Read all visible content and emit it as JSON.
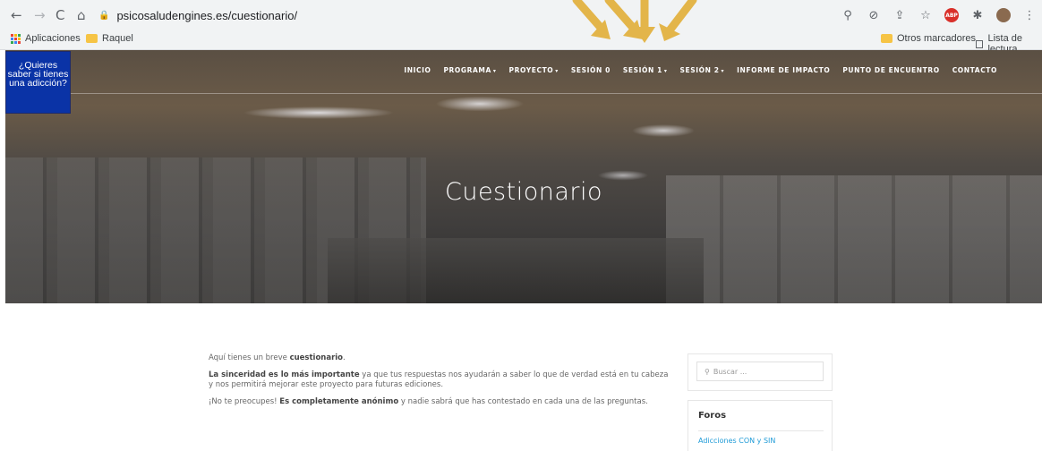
{
  "browser": {
    "url": "psicosaludengines.es/cuestionario/",
    "nav_back": "←",
    "nav_forward": "→",
    "nav_reload": "C",
    "nav_home": "⌂",
    "lock": "🔒",
    "extension_icons": [
      "zoom-icon",
      "eye-off-icon",
      "share-icon",
      "star-icon",
      "adblock-icon",
      "puzzle-icon",
      "profile-avatar",
      "menu-icon"
    ],
    "extension_glyphs": [
      "⚲",
      "⊘",
      "⇪",
      "☆",
      "ABP",
      "✱",
      "●",
      "⋮"
    ],
    "bookmarks": {
      "apps": "Aplicaciones",
      "item1": "Raquel",
      "others": "Otros marcadores",
      "reading_list": "Lista de lectura"
    }
  },
  "site": {
    "nav": [
      {
        "label": "INICIO",
        "caret": false
      },
      {
        "label": "PROGRAMA",
        "caret": true
      },
      {
        "label": "PROYECTO",
        "caret": true
      },
      {
        "label": "SESIÓN 0",
        "caret": false
      },
      {
        "label": "SESIÓN 1",
        "caret": true
      },
      {
        "label": "SESIÓN 2",
        "caret": true
      },
      {
        "label": "INFORME DE IMPACTO",
        "caret": false
      },
      {
        "label": "PUNTO DE ENCUENTRO",
        "caret": false
      },
      {
        "label": "CONTACTO",
        "caret": false
      }
    ],
    "caret_glyph": "▾",
    "hero_title": "Cuestionario",
    "widget": {
      "line1": "¿Quieres",
      "line2": "saber si tienes",
      "line3": "una adicción?"
    }
  },
  "content": {
    "p1_pre": "Aquí tienes un breve ",
    "p1_bold": "cuestionario",
    "p1_post": ".",
    "p2_bold": "La sinceridad es lo más importante",
    "p2_post": " ya que tus respuestas nos ayudarán a saber lo que de verdad está en tu cabeza y nos permitirá mejorar este proyecto para futuras ediciones.",
    "p3_pre": "¡No te preocupes! ",
    "p3_bold": "Es completamente anónimo",
    "p3_post": " y nadie sabrá que has contestado en cada una de las preguntas."
  },
  "sidebar": {
    "search_placeholder": "Buscar ...",
    "foros_title": "Foros",
    "foros_link": "Adicciones CON y SIN"
  },
  "colors": {
    "widget_bg": "#0a33a6",
    "arrow": "#e3b54a",
    "link": "#1f9bd7"
  }
}
